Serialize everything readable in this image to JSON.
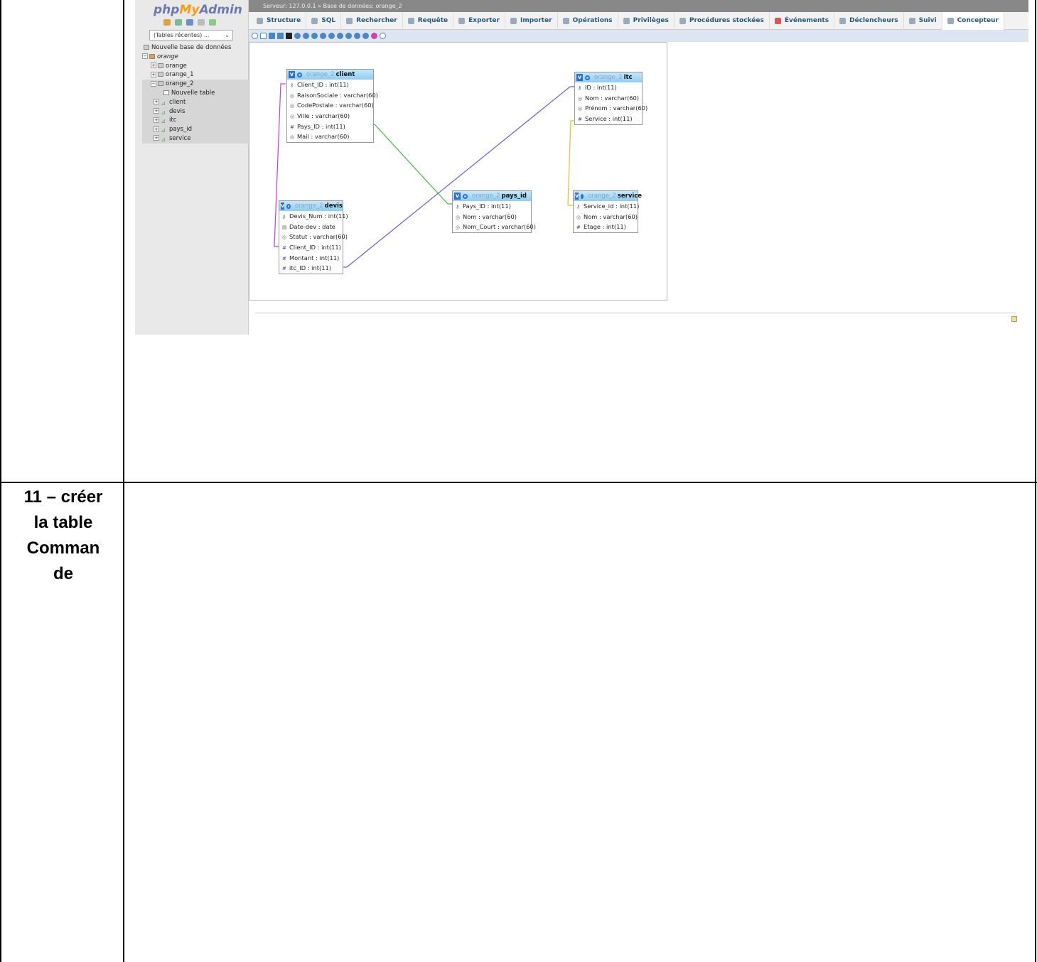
{
  "step_label": "11 – créer la table Commande",
  "step_label_lines": [
    "11 – créer",
    "la table",
    "Comman",
    "de"
  ],
  "pma": {
    "logo": {
      "php": "php",
      "my": "My",
      "admin": "Admin"
    },
    "recent_tables": "(Tables récentes) ...",
    "tree": {
      "new_db": "Nouvelle base de données",
      "current_db": "orange",
      "databases": [
        "orange",
        "orange_1",
        "orange_2"
      ],
      "new_table": "Nouvelle table",
      "tables": [
        "client",
        "devis",
        "itc",
        "pays_id",
        "service"
      ]
    },
    "breadcrumb": "Serveur: 127.0.0.1 » Base de données: orange_2",
    "tabs": [
      "Structure",
      "SQL",
      "Rechercher",
      "Requête",
      "Exporter",
      "Importer",
      "Opérations",
      "Privilèges",
      "Procédures stockées",
      "Événements",
      "Déclencheurs",
      "Suivi",
      "Concepteur"
    ],
    "active_tab": "Concepteur",
    "designer": {
      "db_prefix": "orange_2",
      "tables": {
        "client": {
          "name": "client",
          "cols": [
            "Client_ID : int(11)",
            "RaisonSociale : varchar(60)",
            "CodePostale : varchar(60)",
            "Ville : varchar(60)",
            "Pays_ID : int(11)",
            "Mail : varchar(60)"
          ]
        },
        "devis": {
          "name": "devis",
          "cols": [
            "Devis_Num : int(11)",
            "Date-dev : date",
            "Statut : varchar(60)",
            "Client_ID : int(11)",
            "Montant : int(11)",
            "itc_ID : int(11)"
          ]
        },
        "pays_id": {
          "name": "pays_id",
          "cols": [
            "Pays_ID : int(11)",
            "Nom : varchar(60)",
            "Nom_Court : varchar(60)"
          ]
        },
        "itc": {
          "name": "itc",
          "cols": [
            "ID : int(11)",
            "Nom : varchar(60)",
            "Prénom : varchar(60)",
            "Service : int(11)"
          ]
        },
        "service": {
          "name": "service",
          "cols": [
            "Service_id : int(11)",
            "Nom : varchar(60)",
            "Etage : int(11)"
          ]
        }
      },
      "relation_colors": {
        "client_devis": "#d33ad3",
        "client_pays": "#3cc03c",
        "devis_itc": "#6f5bd8",
        "itc_service": "#e0c21f"
      }
    }
  }
}
